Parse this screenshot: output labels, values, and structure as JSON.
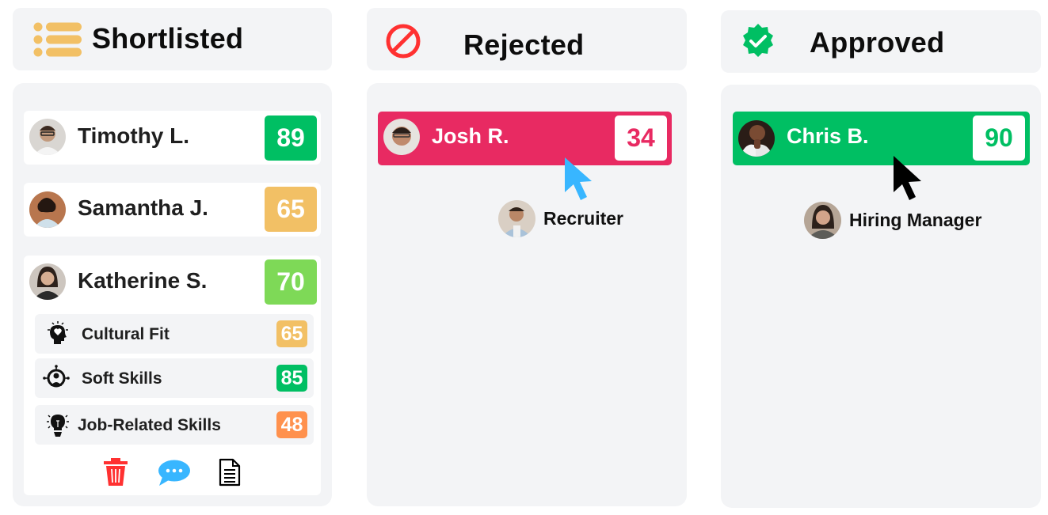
{
  "columns": {
    "shortlisted": {
      "title": "Shortlisted",
      "icon": "list-icon",
      "icon_color": "#f2c065",
      "candidates": [
        {
          "name": "Timothy L.",
          "score": "89",
          "score_color": "#00bf63"
        },
        {
          "name": "Samantha J.",
          "score": "65",
          "score_color": "#f2c065"
        },
        {
          "name": "Katherine S.",
          "score": "70",
          "score_color": "#7ed957",
          "expanded": true,
          "breakdown": [
            {
              "label": "Cultural Fit",
              "score": "65",
              "score_color": "#f2c065",
              "icon": "head-heart-icon"
            },
            {
              "label": "Soft Skills",
              "score": "85",
              "score_color": "#00bf63",
              "icon": "person-network-icon"
            },
            {
              "label": "Job-Related Skills",
              "score": "48",
              "score_color": "#ff914d",
              "icon": "lightbulb-icon"
            }
          ],
          "actions": [
            {
              "name": "delete",
              "icon": "trash-icon",
              "color": "#ff3131"
            },
            {
              "name": "comment",
              "icon": "chat-bubble-icon",
              "color": "#38b6ff"
            },
            {
              "name": "document",
              "icon": "document-icon",
              "color": "#000000"
            }
          ]
        }
      ]
    },
    "rejected": {
      "title": "Rejected",
      "icon": "prohibited-icon",
      "icon_color": "#ff3131",
      "dragged_candidate": {
        "name": "Josh R.",
        "score": "34",
        "card_color": "#e82a62"
      },
      "cursor_color": "#38b6ff",
      "user": {
        "label": "Recruiter"
      }
    },
    "approved": {
      "title": "Approved",
      "icon": "verified-badge-icon",
      "icon_color": "#00bf63",
      "dragged_candidate": {
        "name": "Chris B.",
        "score": "90",
        "card_color": "#00bf63"
      },
      "cursor_color": "#000000",
      "user": {
        "label": "Hiring Manager"
      }
    }
  }
}
